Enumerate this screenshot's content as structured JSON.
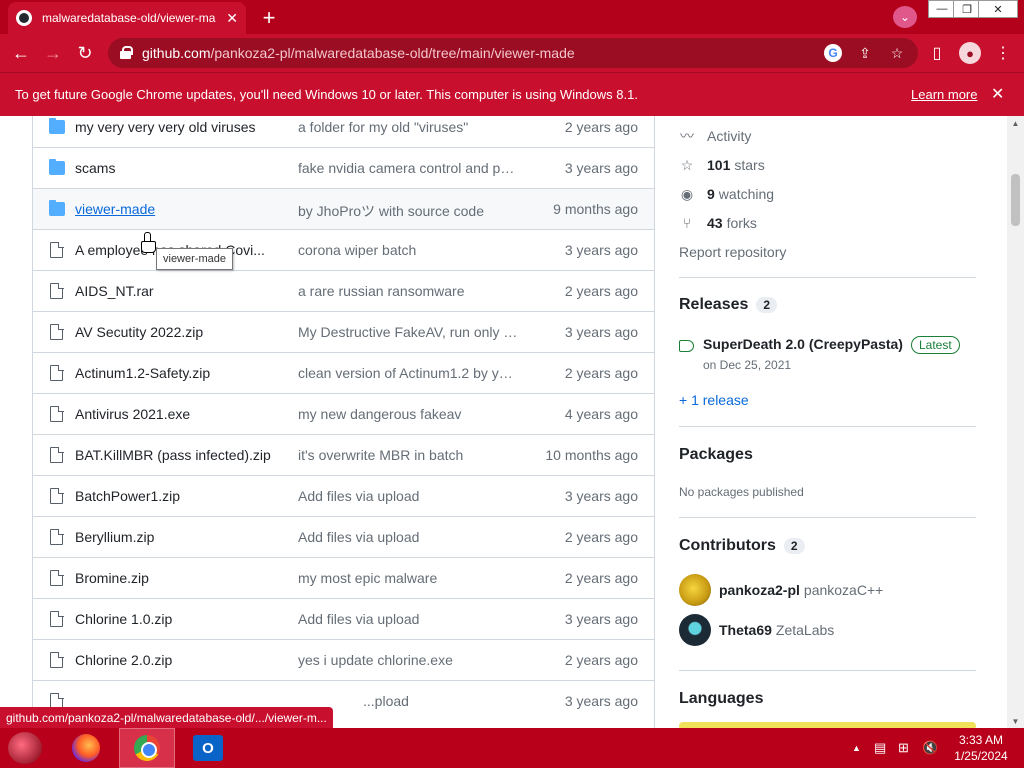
{
  "browser": {
    "tab_title": "malwaredatabase-old/viewer-ma",
    "new_tab_symbol": "+",
    "url_host": "github.com",
    "url_path": "/pankoza2-pl/malwaredatabase-old/tree/main/viewer-made"
  },
  "infobar": {
    "message": "To get future Google Chrome updates, you'll need Windows 10 or later. This computer is using Windows 8.1.",
    "learn_more": "Learn more"
  },
  "files": [
    {
      "name": "my very very very old viruses",
      "message": "a folder for my old \"viruses\"",
      "age": "2 years ago",
      "type": "folder"
    },
    {
      "name": "scams",
      "message": "fake nvidia camera control and ph...",
      "age": "3 years ago",
      "type": "folder"
    },
    {
      "name": "viewer-made",
      "message": "by JhoProツ with source code",
      "age": "9 months ago",
      "type": "folder"
    },
    {
      "name": "A employee has shared Covi...",
      "message": "corona wiper batch",
      "age": "3 years ago",
      "type": "file"
    },
    {
      "name": "AIDS_NT.rar",
      "message": "a rare russian ransomware",
      "age": "2 years ago",
      "type": "file"
    },
    {
      "name": "AV Secutity 2022.zip",
      "message": "My Destructive FakeAV, run only o...",
      "age": "3 years ago",
      "type": "file"
    },
    {
      "name": "Actinum1.2-Safety.zip",
      "message": "clean version of Actinum1.2 by yo...",
      "age": "2 years ago",
      "type": "file"
    },
    {
      "name": "Antivirus 2021.exe",
      "message": "my new dangerous fakeav",
      "age": "4 years ago",
      "type": "file"
    },
    {
      "name": "BAT.KillMBR (pass infected).zip",
      "message": "it's overwrite MBR in batch",
      "age": "10 months ago",
      "type": "file"
    },
    {
      "name": "BatchPower1.zip",
      "message": "Add files via upload",
      "age": "3 years ago",
      "type": "file"
    },
    {
      "name": "Beryllium.zip",
      "message": "Add files via upload",
      "age": "2 years ago",
      "type": "file"
    },
    {
      "name": "Bromine.zip",
      "message": "my most epic malware",
      "age": "2 years ago",
      "type": "file"
    },
    {
      "name": "Chlorine 1.0.zip",
      "message": "Add files via upload",
      "age": "3 years ago",
      "type": "file"
    },
    {
      "name": "Chlorine 2.0.zip",
      "message": "yes i update chlorine.exe",
      "age": "2 years ago",
      "type": "file"
    },
    {
      "name": "",
      "message": "...pload",
      "age": "3 years ago",
      "type": "file"
    }
  ],
  "tooltip": "viewer-made",
  "sidebar": {
    "activity": "Activity",
    "stars_count": "101",
    "stars_label": "stars",
    "watching_count": "9",
    "watching_label": "watching",
    "forks_count": "43",
    "forks_label": "forks",
    "report": "Report repository",
    "releases_heading": "Releases",
    "releases_count": "2",
    "release_title": "SuperDeath 2.0 (CreepyPasta)",
    "release_badge": "Latest",
    "release_date": "on Dec 25, 2021",
    "more_releases": "+ 1 release",
    "packages_heading": "Packages",
    "packages_empty": "No packages published",
    "contributors_heading": "Contributors",
    "contributors_count": "2",
    "contributors": [
      {
        "login": "pankoza2-pl",
        "name": "pankozaC++"
      },
      {
        "login": "Theta69",
        "name": "ZetaLabs"
      }
    ],
    "languages_heading": "Languages"
  },
  "status_url": "github.com/pankoza2-pl/malwaredatabase-old/.../viewer-m...",
  "taskbar": {
    "outlook_letter": "O",
    "time": "3:33 AM",
    "date": "1/25/2024"
  },
  "colors": {
    "chrome_theme": "#c8102e",
    "taskbar": "#b8001a",
    "link": "#0969da",
    "latest_badge": "#1a7f37"
  }
}
